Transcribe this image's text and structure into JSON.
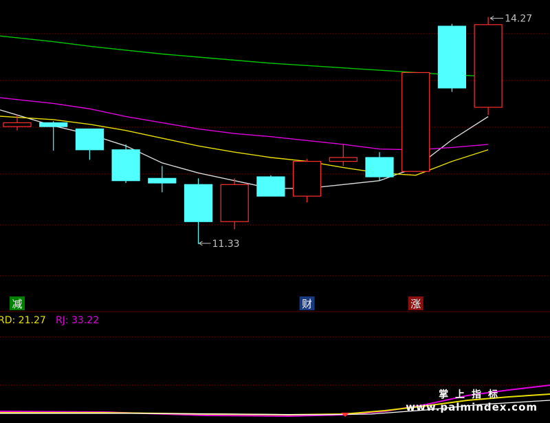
{
  "chart_data": {
    "type": "candlestick",
    "ylim": [
      10.5,
      14.4
    ],
    "candles": [
      {
        "open": 12.85,
        "close": 12.9,
        "high": 13.0,
        "low": 12.8
      },
      {
        "open": 12.9,
        "close": 12.85,
        "high": 12.92,
        "low": 12.54
      },
      {
        "open": 12.82,
        "close": 12.55,
        "high": 12.82,
        "low": 12.42
      },
      {
        "open": 12.55,
        "close": 12.15,
        "high": 12.62,
        "low": 12.12
      },
      {
        "open": 12.18,
        "close": 12.12,
        "high": 12.34,
        "low": 12.0
      },
      {
        "open": 12.1,
        "close": 11.62,
        "high": 12.18,
        "low": 11.33
      },
      {
        "open": 11.62,
        "close": 12.1,
        "high": 12.18,
        "low": 11.52
      },
      {
        "open": 12.2,
        "close": 11.95,
        "high": 12.22,
        "low": 11.95
      },
      {
        "open": 11.95,
        "close": 12.4,
        "high": 12.43,
        "low": 11.87
      },
      {
        "open": 12.4,
        "close": 12.45,
        "high": 12.62,
        "low": 12.34
      },
      {
        "open": 12.45,
        "close": 12.2,
        "high": 12.52,
        "low": 12.15
      },
      {
        "open": 12.27,
        "close": 13.55,
        "high": 13.55,
        "low": 12.27
      },
      {
        "open": 14.15,
        "close": 13.35,
        "high": 14.18,
        "low": 13.3
      },
      {
        "open": 13.1,
        "close": 14.17,
        "high": 14.27,
        "low": 13.0
      }
    ],
    "lines": [
      {
        "name": "MA-white",
        "color": "#d8d8d8",
        "values": [
          13.0,
          12.86,
          12.75,
          12.6,
          12.38,
          12.25,
          12.15,
          12.05,
          12.05,
          12.1,
          12.15,
          12.32,
          12.68,
          12.98
        ]
      },
      {
        "name": "MA-yellow",
        "color": "#e8e000",
        "values": [
          12.97,
          12.94,
          12.88,
          12.8,
          12.7,
          12.6,
          12.52,
          12.45,
          12.4,
          12.32,
          12.25,
          12.22,
          12.4,
          12.55
        ]
      },
      {
        "name": "MA-magenta",
        "color": "#e000e0",
        "values": [
          13.2,
          13.15,
          13.08,
          12.98,
          12.9,
          12.82,
          12.76,
          12.72,
          12.67,
          12.62,
          12.56,
          12.55,
          12.58,
          12.62
        ]
      },
      {
        "name": "MA-green",
        "color": "#00c800",
        "values": [
          14.0,
          13.95,
          13.89,
          13.84,
          13.79,
          13.75,
          13.71,
          13.67,
          13.64,
          13.61,
          13.58,
          13.55,
          13.52,
          13.5
        ]
      }
    ],
    "annotations": {
      "high_label": "14.27",
      "low_label": "11.33"
    },
    "badges": [
      {
        "text": "减",
        "candle_index": 0,
        "color": "#008000"
      },
      {
        "text": "财",
        "candle_index": 8,
        "color": "#1a3a80"
      },
      {
        "text": "涨",
        "candle_index": 11,
        "color": "#8a1010"
      }
    ],
    "indicator": {
      "legend": [
        {
          "text": "RD: 21.27",
          "color": "#e8e000"
        },
        {
          "text": "RJ: 33.22",
          "color": "#e000e0"
        }
      ]
    }
  },
  "colors": {
    "up": "#ff3030",
    "down": "#50ffff",
    "wick_down": "#50ffff",
    "grid": "#8b0000",
    "label": "#c0c0c0"
  },
  "watermark": {
    "title": "掌上指标",
    "url": "www.palmindex.com"
  }
}
